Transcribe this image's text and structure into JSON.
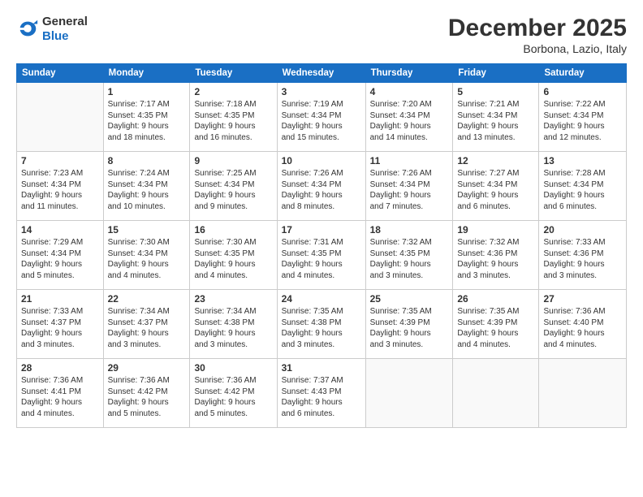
{
  "header": {
    "logo_general": "General",
    "logo_blue": "Blue",
    "month": "December 2025",
    "location": "Borbona, Lazio, Italy"
  },
  "days_of_week": [
    "Sunday",
    "Monday",
    "Tuesday",
    "Wednesday",
    "Thursday",
    "Friday",
    "Saturday"
  ],
  "weeks": [
    [
      {
        "day": "",
        "info": ""
      },
      {
        "day": "1",
        "info": "Sunrise: 7:17 AM\nSunset: 4:35 PM\nDaylight: 9 hours\nand 18 minutes."
      },
      {
        "day": "2",
        "info": "Sunrise: 7:18 AM\nSunset: 4:35 PM\nDaylight: 9 hours\nand 16 minutes."
      },
      {
        "day": "3",
        "info": "Sunrise: 7:19 AM\nSunset: 4:34 PM\nDaylight: 9 hours\nand 15 minutes."
      },
      {
        "day": "4",
        "info": "Sunrise: 7:20 AM\nSunset: 4:34 PM\nDaylight: 9 hours\nand 14 minutes."
      },
      {
        "day": "5",
        "info": "Sunrise: 7:21 AM\nSunset: 4:34 PM\nDaylight: 9 hours\nand 13 minutes."
      },
      {
        "day": "6",
        "info": "Sunrise: 7:22 AM\nSunset: 4:34 PM\nDaylight: 9 hours\nand 12 minutes."
      }
    ],
    [
      {
        "day": "7",
        "info": "Sunrise: 7:23 AM\nSunset: 4:34 PM\nDaylight: 9 hours\nand 11 minutes."
      },
      {
        "day": "8",
        "info": "Sunrise: 7:24 AM\nSunset: 4:34 PM\nDaylight: 9 hours\nand 10 minutes."
      },
      {
        "day": "9",
        "info": "Sunrise: 7:25 AM\nSunset: 4:34 PM\nDaylight: 9 hours\nand 9 minutes."
      },
      {
        "day": "10",
        "info": "Sunrise: 7:26 AM\nSunset: 4:34 PM\nDaylight: 9 hours\nand 8 minutes."
      },
      {
        "day": "11",
        "info": "Sunrise: 7:26 AM\nSunset: 4:34 PM\nDaylight: 9 hours\nand 7 minutes."
      },
      {
        "day": "12",
        "info": "Sunrise: 7:27 AM\nSunset: 4:34 PM\nDaylight: 9 hours\nand 6 minutes."
      },
      {
        "day": "13",
        "info": "Sunrise: 7:28 AM\nSunset: 4:34 PM\nDaylight: 9 hours\nand 6 minutes."
      }
    ],
    [
      {
        "day": "14",
        "info": "Sunrise: 7:29 AM\nSunset: 4:34 PM\nDaylight: 9 hours\nand 5 minutes."
      },
      {
        "day": "15",
        "info": "Sunrise: 7:30 AM\nSunset: 4:34 PM\nDaylight: 9 hours\nand 4 minutes."
      },
      {
        "day": "16",
        "info": "Sunrise: 7:30 AM\nSunset: 4:35 PM\nDaylight: 9 hours\nand 4 minutes."
      },
      {
        "day": "17",
        "info": "Sunrise: 7:31 AM\nSunset: 4:35 PM\nDaylight: 9 hours\nand 4 minutes."
      },
      {
        "day": "18",
        "info": "Sunrise: 7:32 AM\nSunset: 4:35 PM\nDaylight: 9 hours\nand 3 minutes."
      },
      {
        "day": "19",
        "info": "Sunrise: 7:32 AM\nSunset: 4:36 PM\nDaylight: 9 hours\nand 3 minutes."
      },
      {
        "day": "20",
        "info": "Sunrise: 7:33 AM\nSunset: 4:36 PM\nDaylight: 9 hours\nand 3 minutes."
      }
    ],
    [
      {
        "day": "21",
        "info": "Sunrise: 7:33 AM\nSunset: 4:37 PM\nDaylight: 9 hours\nand 3 minutes."
      },
      {
        "day": "22",
        "info": "Sunrise: 7:34 AM\nSunset: 4:37 PM\nDaylight: 9 hours\nand 3 minutes."
      },
      {
        "day": "23",
        "info": "Sunrise: 7:34 AM\nSunset: 4:38 PM\nDaylight: 9 hours\nand 3 minutes."
      },
      {
        "day": "24",
        "info": "Sunrise: 7:35 AM\nSunset: 4:38 PM\nDaylight: 9 hours\nand 3 minutes."
      },
      {
        "day": "25",
        "info": "Sunrise: 7:35 AM\nSunset: 4:39 PM\nDaylight: 9 hours\nand 3 minutes."
      },
      {
        "day": "26",
        "info": "Sunrise: 7:35 AM\nSunset: 4:39 PM\nDaylight: 9 hours\nand 4 minutes."
      },
      {
        "day": "27",
        "info": "Sunrise: 7:36 AM\nSunset: 4:40 PM\nDaylight: 9 hours\nand 4 minutes."
      }
    ],
    [
      {
        "day": "28",
        "info": "Sunrise: 7:36 AM\nSunset: 4:41 PM\nDaylight: 9 hours\nand 4 minutes."
      },
      {
        "day": "29",
        "info": "Sunrise: 7:36 AM\nSunset: 4:42 PM\nDaylight: 9 hours\nand 5 minutes."
      },
      {
        "day": "30",
        "info": "Sunrise: 7:36 AM\nSunset: 4:42 PM\nDaylight: 9 hours\nand 5 minutes."
      },
      {
        "day": "31",
        "info": "Sunrise: 7:37 AM\nSunset: 4:43 PM\nDaylight: 9 hours\nand 6 minutes."
      },
      {
        "day": "",
        "info": ""
      },
      {
        "day": "",
        "info": ""
      },
      {
        "day": "",
        "info": ""
      }
    ]
  ]
}
